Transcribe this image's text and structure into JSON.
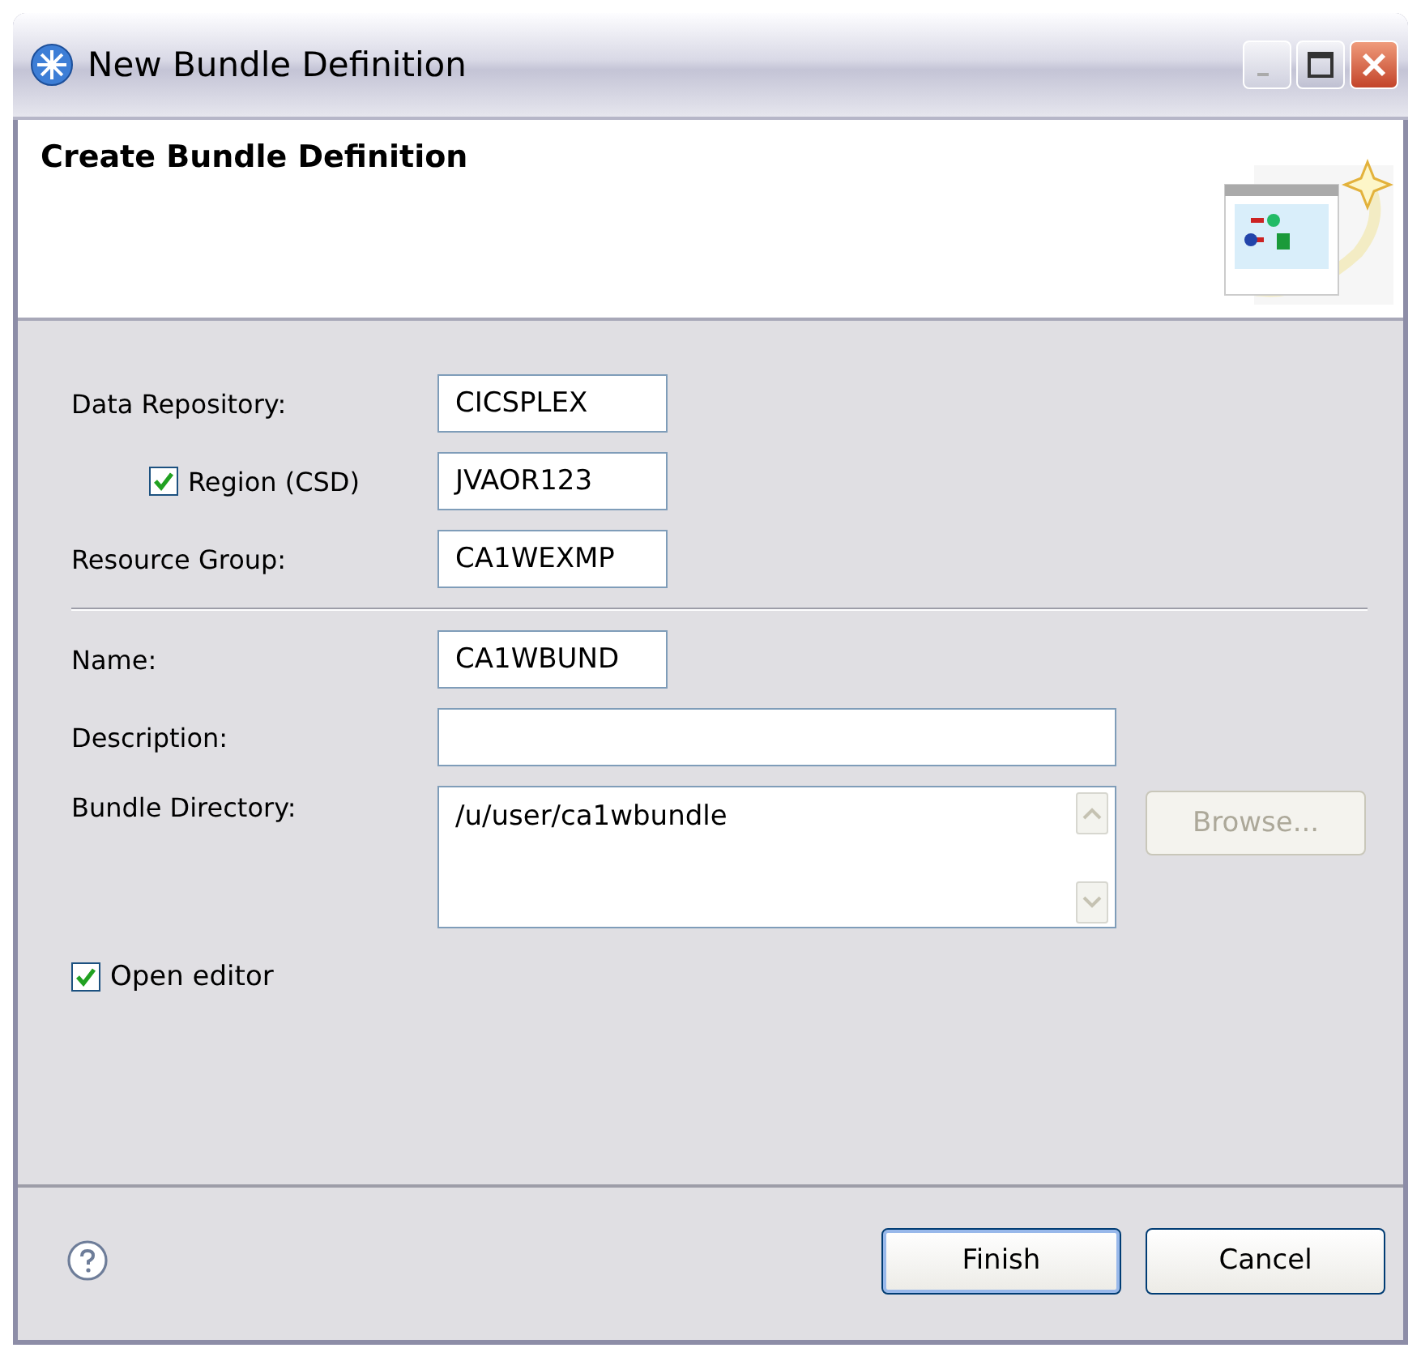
{
  "window": {
    "title": "New Bundle Definition"
  },
  "header": {
    "title": "Create Bundle Definition"
  },
  "fields": [
    {
      "kind": "text",
      "label": "Data Repository:",
      "value": "CICSPLEX"
    },
    {
      "kind": "checkbox-text",
      "label": "Region (CSD)",
      "checked": true,
      "value": "JVAOR123"
    },
    {
      "kind": "text",
      "label": "Resource Group:",
      "value": "CA1WEXMP"
    },
    {
      "kind": "separator"
    },
    {
      "kind": "text",
      "label": "Name:",
      "value": "CA1WBUND"
    },
    {
      "kind": "wide-text",
      "label": "Description:"
    },
    {
      "kind": "browse-area",
      "label": "Bundle Directory:",
      "value": "/u/user/ca1wbundle",
      "button": {
        "label": "Browse...",
        "disabled": true
      }
    }
  ],
  "open_editor": {
    "label": "Open editor",
    "checked": true
  },
  "buttons": [
    {
      "label": "Finish",
      "default": true
    },
    {
      "label": "Cancel",
      "default": false
    }
  ]
}
